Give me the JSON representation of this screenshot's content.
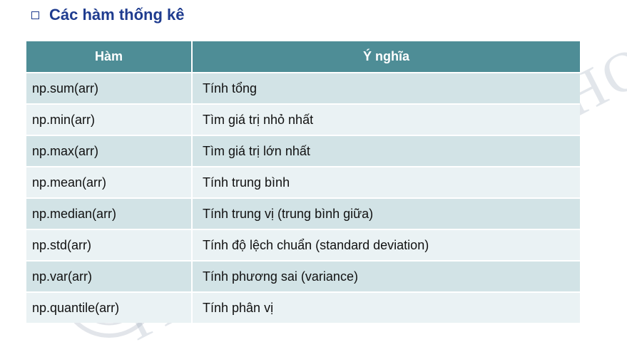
{
  "slide": {
    "title": "Các hàm thống kê",
    "watermark_line1": "TRƯỜNG ĐẠI HỌC KHOA HỌC TỰ NHIÊN",
    "watermark_line2": "TRUNG TÂM TIN HỌC"
  },
  "table": {
    "headers": [
      "Hàm",
      "Ý nghĩa"
    ],
    "rows": [
      {
        "fn": "np.sum(arr)",
        "desc": "Tính tổng"
      },
      {
        "fn": "np.min(arr)",
        "desc": "Tìm giá trị nhỏ nhất"
      },
      {
        "fn": "np.max(arr)",
        "desc": "Tìm giá trị lớn nhất"
      },
      {
        "fn": "np.mean(arr)",
        "desc": "Tính trung bình"
      },
      {
        "fn": "np.median(arr)",
        "desc": "Tính trung vị (trung bình giữa)"
      },
      {
        "fn": "np.std(arr)",
        "desc": "Tính độ lệch chuẩn (standard deviation)"
      },
      {
        "fn": "np.var(arr)",
        "desc": "Tính phương sai (variance)"
      },
      {
        "fn": "np.quantile(arr)",
        "desc": "Tính phân vị"
      }
    ]
  },
  "colors": {
    "title": "#1f3c8f",
    "header_bg": "#4e8d96",
    "row_odd": "#d2e3e6",
    "row_even": "#eaf2f4"
  }
}
